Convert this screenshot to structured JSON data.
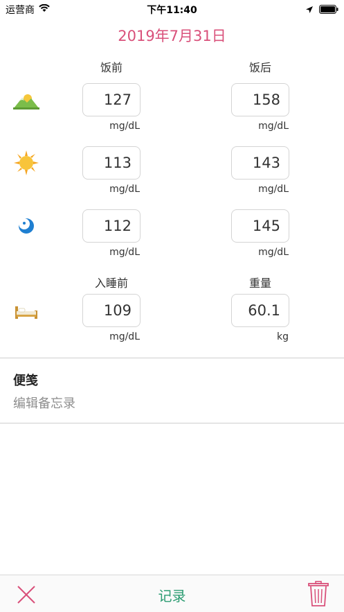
{
  "status_bar": {
    "carrier": "运营商",
    "time": "下午11:40"
  },
  "date_title": "2019年7月31日",
  "headers": {
    "before_meal": "饭前",
    "after_meal": "饭后",
    "before_sleep": "入睡前",
    "weight": "重量"
  },
  "rows": [
    {
      "icon": "mountain-morning-icon",
      "before": "127",
      "after": "158",
      "before_unit": "mg/dL",
      "after_unit": "mg/dL"
    },
    {
      "icon": "sun-icon",
      "before": "113",
      "after": "143",
      "before_unit": "mg/dL",
      "after_unit": "mg/dL"
    },
    {
      "icon": "moon-icon",
      "before": "112",
      "after": "145",
      "before_unit": "mg/dL",
      "after_unit": "mg/dL"
    }
  ],
  "sleep_row": {
    "icon": "bed-icon",
    "before_sleep": "109",
    "before_sleep_unit": "mg/dL",
    "weight": "60.1",
    "weight_unit": "kg"
  },
  "note": {
    "title": "便笺",
    "placeholder": "编辑备忘录"
  },
  "toolbar": {
    "record_label": "记录"
  },
  "colors": {
    "accent_pink": "#d9507a",
    "accent_green": "#2c9c72"
  }
}
